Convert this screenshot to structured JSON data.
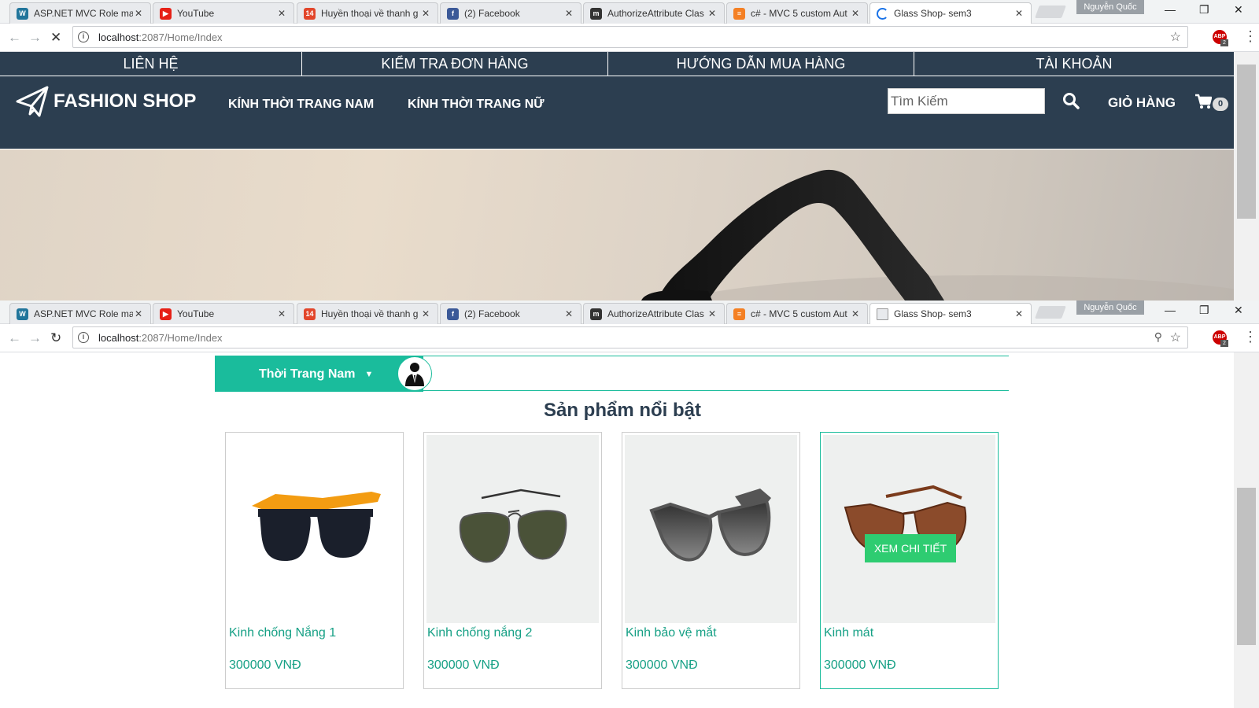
{
  "browser": {
    "tabs": [
      {
        "title": "ASP.NET MVC Role mar",
        "icon": "wordpress-icon",
        "color": "#21759b"
      },
      {
        "title": "YouTube",
        "icon": "youtube-icon",
        "color": "#e62117"
      },
      {
        "title": "Huyền thoại về thanh g",
        "icon": "site-14-icon",
        "color": "#e2462b"
      },
      {
        "title": "(2) Facebook",
        "icon": "facebook-icon",
        "color": "#3b5998"
      },
      {
        "title": "AuthorizeAttribute Clas",
        "icon": "m-icon",
        "color": "#333333"
      },
      {
        "title": "c# - MVC 5 custom Aut",
        "icon": "stackoverflow-icon",
        "color": "#f48024"
      },
      {
        "title": "Glass Shop- sem3",
        "icon": "page-icon",
        "color": "#1a73e8"
      }
    ],
    "profile_name": "Nguyễn Quốc",
    "url_host": "localhost",
    "url_path": ":2087/Home/Index",
    "abp_label": "ABP",
    "abp_count": "2"
  },
  "site": {
    "top_nav": [
      "LIÊN HỆ",
      "KIỂM TRA ĐƠN HÀNG",
      "HƯỚNG DẪN MUA HÀNG",
      "TÀI KHOẢN"
    ],
    "logo_text": "FASHION SHOP",
    "menu": [
      "KÍNH THỜI TRANG NAM",
      "KÍNH THỜI TRANG NỮ"
    ],
    "search_placeholder": "Tìm Kiếm",
    "cart_label": "GIỎ HÀNG",
    "cart_count": "0",
    "category_tab": "Thời Trang Nam",
    "section_title": "Sản phẩm nổi bật",
    "detail_button": "XEM CHI TIẾT",
    "products": [
      {
        "name": "Kinh chống Nắng 1",
        "price": "300000 VNĐ"
      },
      {
        "name": "Kinh chống nắng 2",
        "price": "300000 VNĐ"
      },
      {
        "name": "Kinh bảo vệ mắt",
        "price": "300000 VNĐ"
      },
      {
        "name": "Kinh mát",
        "price": "300000 VNĐ"
      }
    ]
  },
  "colors": {
    "nav_bg": "#2c3e50",
    "accent": "#1abc9c",
    "product_text": "#16a085",
    "detail_button": "#2ecc71"
  }
}
